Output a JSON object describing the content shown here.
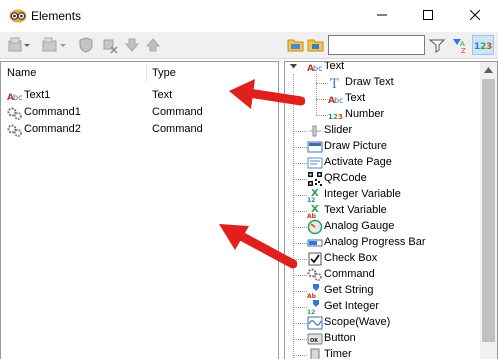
{
  "window": {
    "title": "Elements",
    "icon": "goggles-app-icon"
  },
  "toolbar": {
    "left_buttons": [
      "add-element-icon",
      "add-dropdown-icon",
      "shield-icon",
      "delete-icon",
      "move-down-icon",
      "move-up-icon"
    ],
    "right_buttons": [
      "folder-expand-icon",
      "folder-collapse-icon"
    ],
    "search_value": "",
    "search_placeholder": "",
    "filter_icon": "filter-icon",
    "sort_icon": "sort-az-icon",
    "number_toggle_icon": "number-123-icon"
  },
  "element_list": {
    "columns": [
      "Name",
      "Type"
    ],
    "rows": [
      {
        "name": "Text1",
        "type": "Text",
        "icon": "abc-text-icon"
      },
      {
        "name": "Command1",
        "type": "Command",
        "icon": "gears-icon"
      },
      {
        "name": "Command2",
        "type": "Command",
        "icon": "gears-icon"
      }
    ]
  },
  "palette": {
    "root": {
      "label": "Text",
      "icon": "abc-text-icon",
      "expanded": true,
      "children": [
        {
          "label": "Draw Text",
          "icon": "draw-text-icon"
        },
        {
          "label": "Text",
          "icon": "abc-text-icon"
        },
        {
          "label": "Number",
          "icon": "number-123-icon"
        }
      ]
    },
    "items": [
      {
        "label": "Slider",
        "icon": "slider-icon"
      },
      {
        "label": "Draw Picture",
        "icon": "picture-icon"
      },
      {
        "label": "Activate Page",
        "icon": "page-icon"
      },
      {
        "label": "QRCode",
        "icon": "qrcode-icon"
      },
      {
        "label": "Integer Variable",
        "icon": "integer-variable-icon"
      },
      {
        "label": "Text Variable",
        "icon": "text-variable-icon"
      },
      {
        "label": "Analog Gauge",
        "icon": "gauge-icon"
      },
      {
        "label": "Analog Progress Bar",
        "icon": "progress-bar-icon"
      },
      {
        "label": "Check Box",
        "icon": "checkbox-icon"
      },
      {
        "label": "Command",
        "icon": "gears-icon"
      },
      {
        "label": "Get String",
        "icon": "get-string-icon"
      },
      {
        "label": "Get Integer",
        "icon": "get-integer-icon"
      },
      {
        "label": "Scope(Wave)",
        "icon": "scope-wave-icon"
      },
      {
        "label": "Button",
        "icon": "button-icon"
      },
      {
        "label": "Timer",
        "icon": "timer-icon"
      }
    ]
  },
  "annotations": {
    "arrow_color": "#e0201c"
  }
}
